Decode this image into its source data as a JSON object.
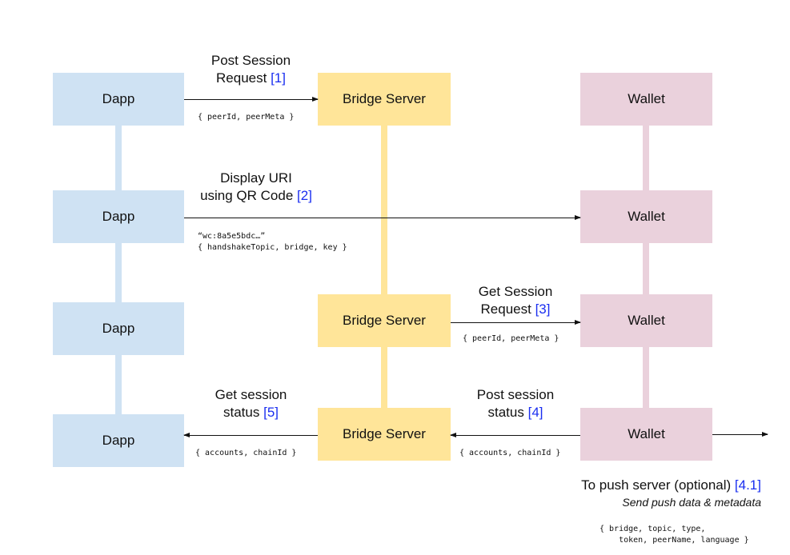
{
  "diagram": {
    "title": "",
    "colors": {
      "dapp": "#cfe2f3",
      "bridge": "#ffe599",
      "wallet": "#ead1dc",
      "reference": "#1a2ef0",
      "arrow": "#111111"
    },
    "actors": {
      "dapp": "Dapp",
      "bridge": "Bridge Server",
      "wallet": "Wallet"
    },
    "rows": [
      {
        "dapp": "Dapp",
        "bridge": "Bridge Server",
        "wallet": "Wallet"
      },
      {
        "dapp": "Dapp",
        "wallet": "Wallet"
      },
      {
        "dapp": "Dapp",
        "bridge": "Bridge Server",
        "wallet": "Wallet"
      },
      {
        "dapp": "Dapp",
        "bridge": "Bridge Server",
        "wallet": "Wallet"
      }
    ],
    "steps": [
      {
        "line1": "Post Session",
        "line2": "Request",
        "ref": "[1]",
        "payload": "{ peerId, peerMeta }",
        "from": "Dapp",
        "to": "Bridge Server"
      },
      {
        "line1": "Display URI",
        "line2": "using QR Code",
        "ref": "[2]",
        "payload_line1": "“wc:8a5e5bdc…”",
        "payload_line2": "{ handshakeTopic, bridge, key }",
        "from": "Dapp",
        "to": "Wallet"
      },
      {
        "line1": "Get Session",
        "line2": "Request",
        "ref": "[3]",
        "payload": "{ peerId, peerMeta }",
        "from": "Bridge Server",
        "to": "Wallet"
      },
      {
        "line1": "Post session",
        "line2": "status",
        "ref": "[4]",
        "payload": "{ accounts, chainId }",
        "from": "Wallet",
        "to": "Bridge Server"
      },
      {
        "line1": "Get session",
        "line2": "status",
        "ref": "[5]",
        "payload": "{ accounts, chainId }",
        "from": "Bridge Server",
        "to": "Dapp"
      }
    ],
    "push": {
      "title": "To push server (optional)",
      "ref": "[4.1]",
      "subtitle": "Send push data & metadata",
      "payload_line1": "{ bridge, topic, type,",
      "payload_line2": "    token, peerName, language }"
    }
  }
}
